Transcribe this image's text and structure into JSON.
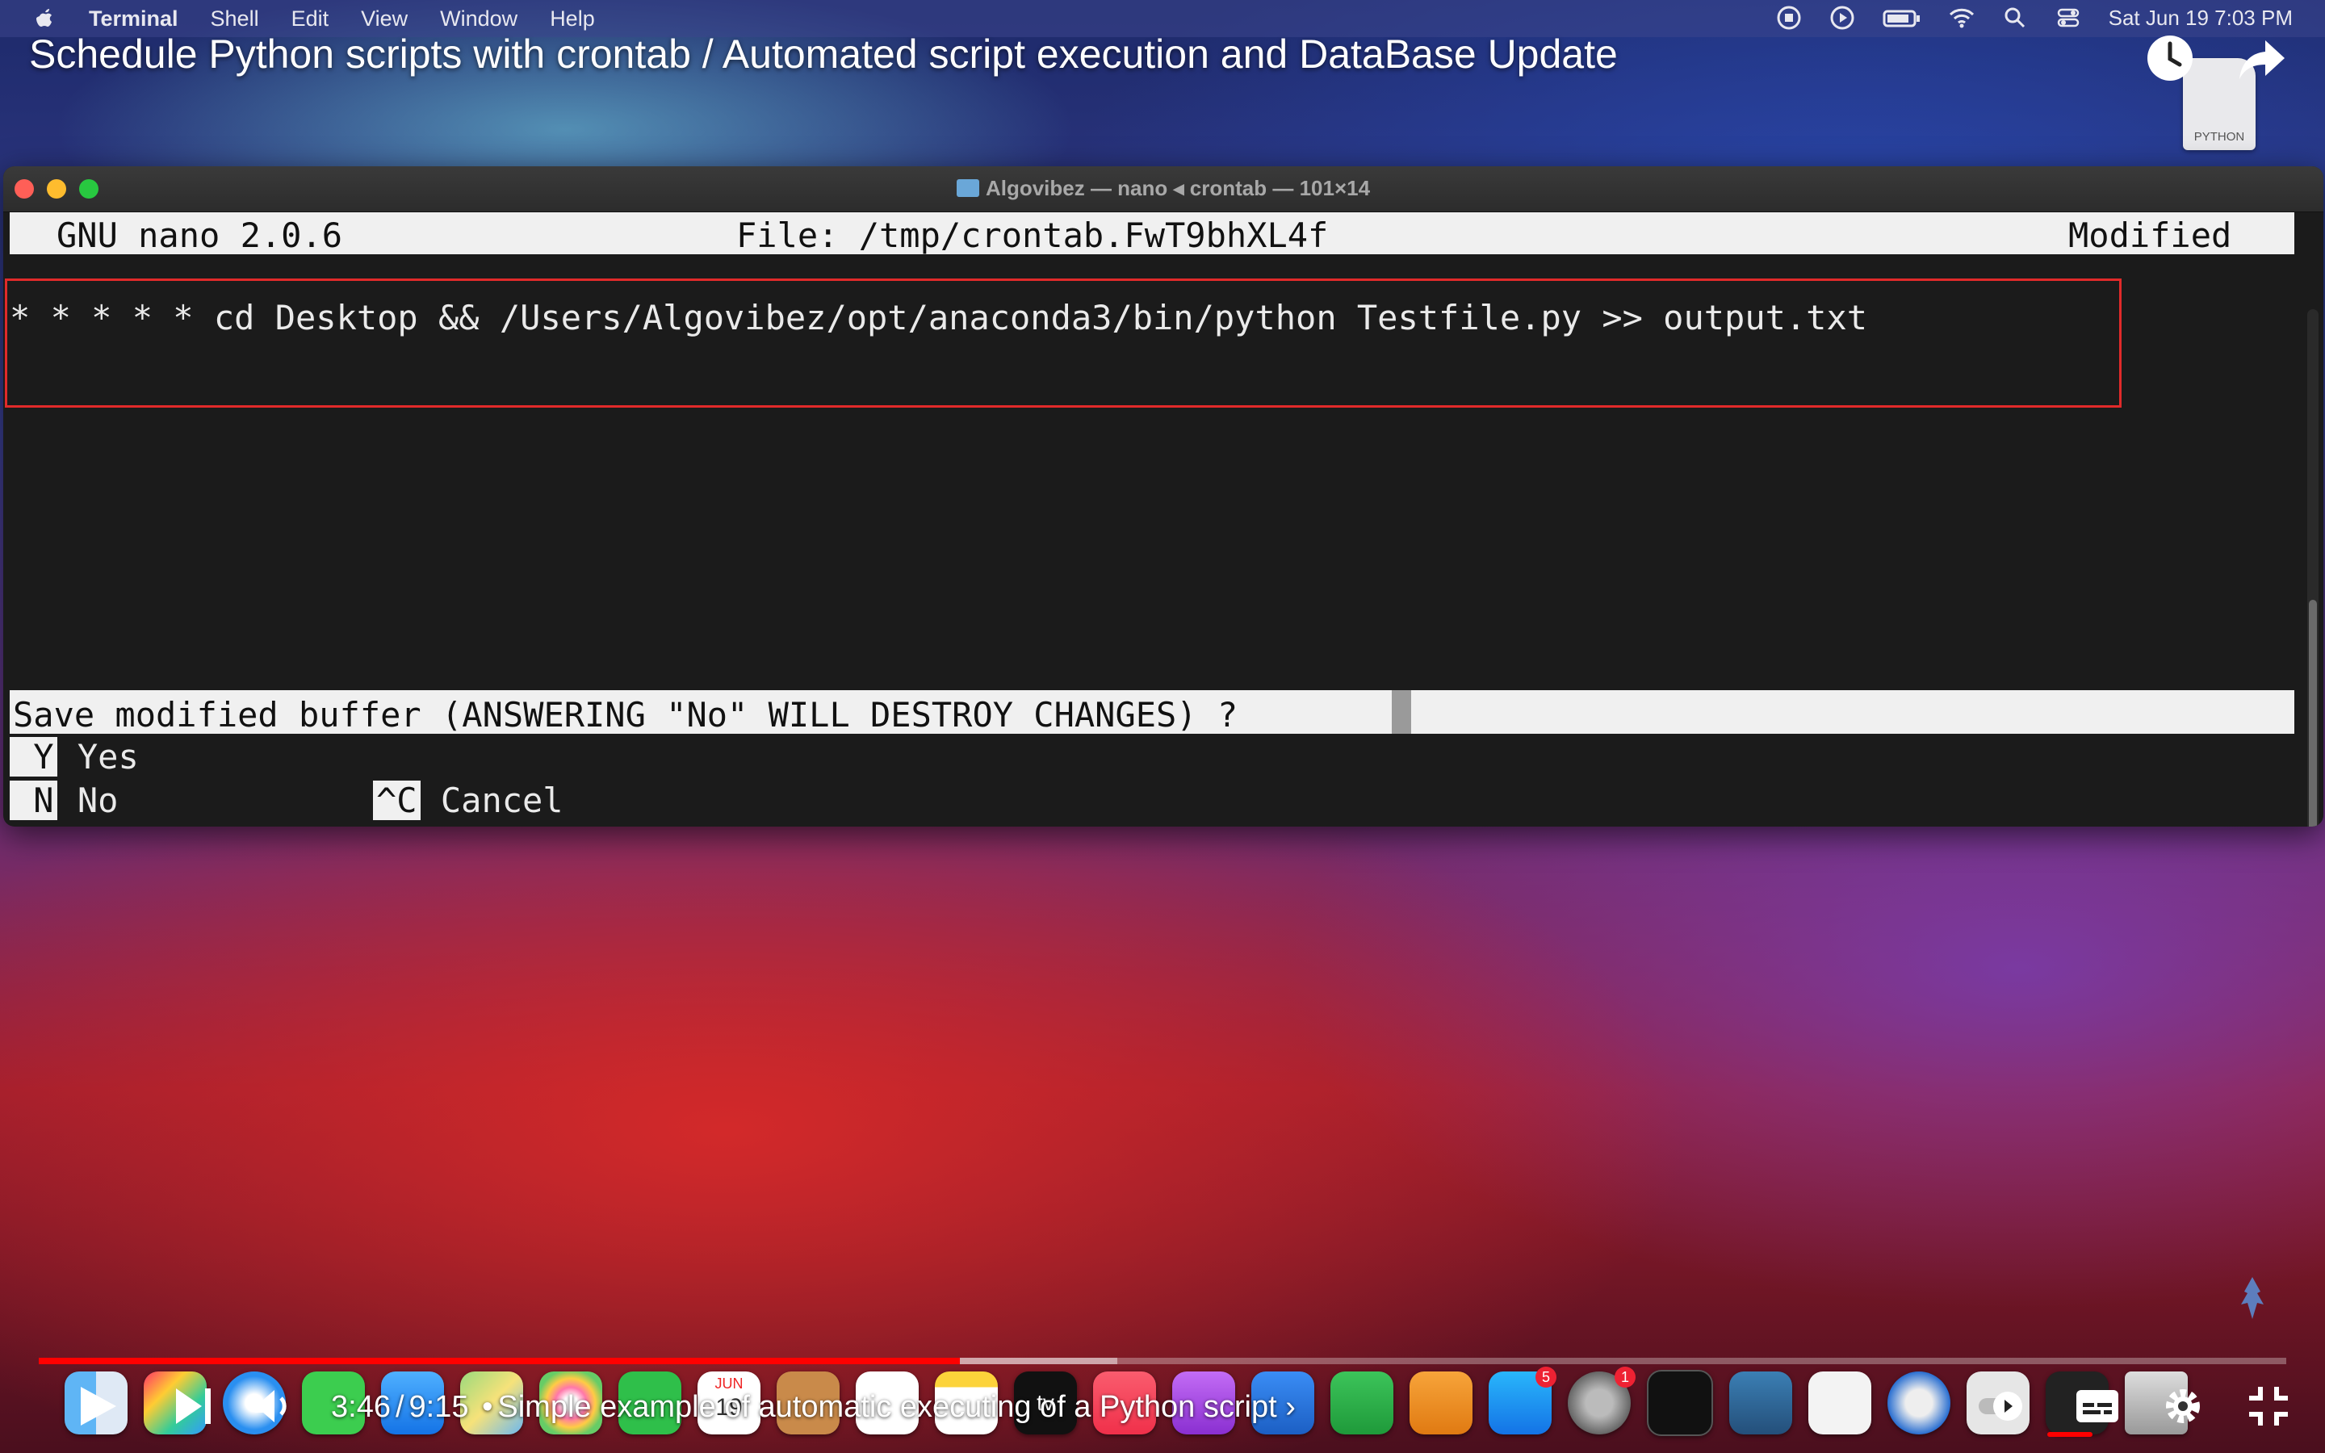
{
  "menubar": {
    "app_name": "Terminal",
    "menus": [
      "Terminal",
      "Shell",
      "Edit",
      "View",
      "Window",
      "Help"
    ],
    "datetime": "Sat Jun 19  7:03 PM"
  },
  "video": {
    "title": "Schedule Python scripts with crontab / Automated script execution and DataBase Update",
    "file_icon_label": "PYTHON",
    "current_time": "3:46",
    "duration": "9:15",
    "time_separator": "/",
    "chapter_separator": "•",
    "chapter": "Simple example of automatic executing of a Python script",
    "chapter_arrow": "›",
    "progress_played": 0.41,
    "progress_loaded": 0.48
  },
  "terminal": {
    "window_title": "Algovibez — nano ◂ crontab — 101×14",
    "nano_version": "GNU nano 2.0.6",
    "file_label": "File: /tmp/crontab.FwT9bhXL4f",
    "status": "Modified",
    "cron_line": "* * * * * cd Desktop && /Users/Algovibez/opt/anaconda3/bin/python Testfile.py >> output.txt",
    "prompt": "Save modified buffer (ANSWERING \"No\" WILL DESTROY CHANGES) ?",
    "options": [
      {
        "key": " Y",
        "label": "Yes"
      },
      {
        "key": " N",
        "label": "No"
      },
      {
        "key": "^C",
        "label": "Cancel"
      }
    ]
  },
  "dock": {
    "badges": {
      "app_store": "5",
      "system_prefs": "1"
    },
    "calendar": {
      "month": "JUN",
      "day": "19"
    },
    "tv_label": "tv"
  },
  "colors": {
    "highlight_box": "#e12a2a",
    "progress_played": "#ff0000"
  }
}
